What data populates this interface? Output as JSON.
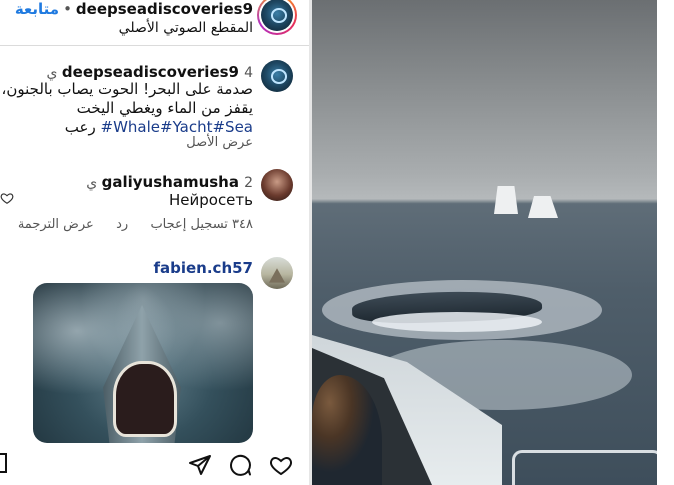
{
  "owner": {
    "username": "deepseadiscoveries9",
    "follow_label": "متابعة",
    "audio_label": "المقطع الصوتي الأصلي"
  },
  "caption": {
    "username": "deepseadiscoveries9",
    "time": "4 ي",
    "lines": [
      "صدمة على البحر! الحوت يصاب بالجنون،",
      "يقفز من الماء ويغطي اليخت"
    ],
    "hashtags": "#Whale#Yacht#Sea",
    "last_word": "رعب",
    "see_original": "عرض الأصل"
  },
  "comment1": {
    "username": "galiyushamusha",
    "time": "2 ي",
    "text": "Нейросеть",
    "likes": "٣٤٨ تسجيل إعجاب",
    "reply": "رد",
    "translate": "عرض الترجمة"
  },
  "comment2": {
    "username": "fabien.ch57"
  },
  "icons": {
    "like": "heart-icon",
    "comment": "comment-icon",
    "share": "send-icon",
    "save": "bookmark-icon"
  }
}
